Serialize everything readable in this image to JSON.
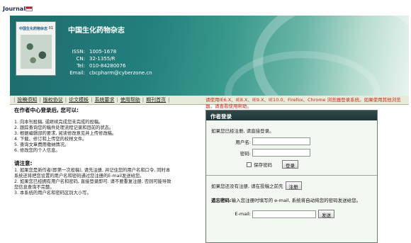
{
  "header": {
    "journal_tag": "Journal",
    "journal_name": "中国生化药物杂志",
    "cover_title": "中国生化药物杂志",
    "cover_number": "01",
    "issn_label": "ISSN:",
    "issn": "1005-1678",
    "cn_label": "CN:",
    "cn": "32-1355/R",
    "tel_label": "Tel:",
    "tel": "010-84280076",
    "email_label": "Email:",
    "email": "cbcpharm@cyberzone.cn"
  },
  "nav": {
    "items": [
      {
        "label": "投稿须知"
      },
      {
        "label": "版权协议"
      },
      {
        "label": "论文模板"
      },
      {
        "label": "系统要求"
      },
      {
        "label": "使用帮助"
      },
      {
        "label": "期刊首页"
      }
    ]
  },
  "left": {
    "title": "在作者中心登录后, 您可以:",
    "items": [
      "1. 向本刊投稿, 或继续完成您未完成的投稿。",
      "2. 跟踪查询您的稿件处理流程记录和目前的状态。",
      "3. 根据编辑部的要求, 阅读修改意见并上传修改稿。",
      "4. 下载、修订和上传您的校样文件。",
      "5. 查询文章费用缴纳情况。",
      "6. 修改您的个人信息。"
    ],
    "notice_title": "请注意:",
    "notices": [
      "1. 如果您是新作者(即第一次投稿), 请先注册, 并记住您的用户名和口令, 同时本",
      "   系统还将把您设置的用户名和密码通过您注册的E-mail发送给您。",
      "2. 如果您已经拥有用户名和密码, 直接登录即可. 请不要重复注册, 否则可能导致",
      "   您信息查询不完整。",
      "3. 本系统的用户名和密码区别大小写。"
    ]
  },
  "right": {
    "browser_note": "请使用IE6.X、IE8.X、IE9.X、IE10.0、Firefox、Chrome 浏览器登录系统。如果使用其他浏览器，请查看使用帮助。",
    "panel_title": "作者登录",
    "registered_text": "如果您已经注册, 请直接登录。",
    "username_label": "用户名:",
    "username_value": "",
    "password_label": "密码:",
    "password_value": "",
    "remember_label": "保存密码",
    "login_button": "登录",
    "register_text": "如果您还没有注册, 请在投稿之前先",
    "register_button": "注册",
    "forgot_bold": "遗忘密码:",
    "forgot_text": "输入您注册时填写的 e-mail, 系统将自动将您的密码发送给您。",
    "email_label": "E-mail:",
    "email_value": "",
    "send_button": "发送"
  },
  "colors": {
    "banner": "#23807c",
    "nav_bg": "#e6ecd9",
    "panel_head": "#2e4a4a",
    "note_red": "#d6231a"
  }
}
